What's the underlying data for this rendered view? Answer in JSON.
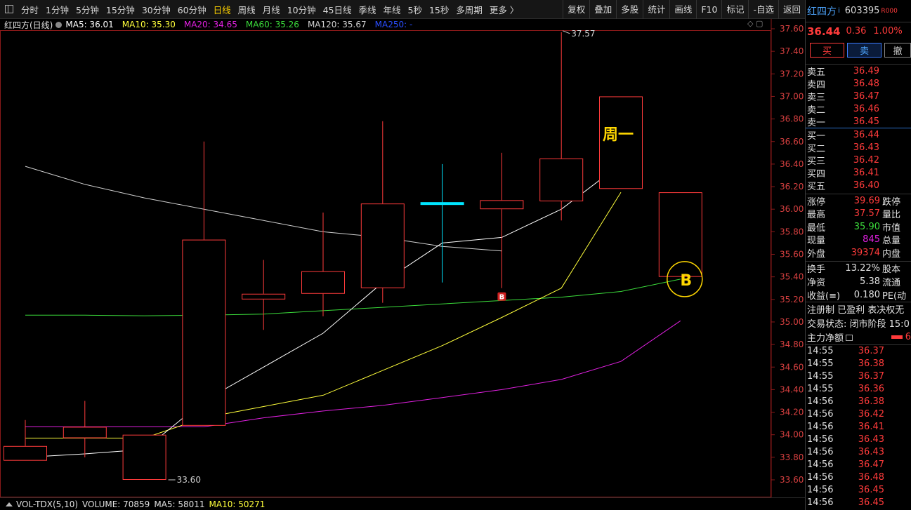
{
  "toolbar": {
    "periods": [
      "分时",
      "1分钟",
      "5分钟",
      "15分钟",
      "30分钟",
      "60分钟",
      "日线",
      "周线",
      "月线",
      "10分钟",
      "45日线",
      "季线",
      "年线",
      "5秒",
      "15秒",
      "多周期",
      "更多 〉"
    ],
    "active_index": 6,
    "right_tools": [
      "复权",
      "叠加",
      "多股",
      "统计",
      "画线",
      "F10",
      "标记",
      "-自选",
      "返回"
    ]
  },
  "ma_bar": {
    "stock": "红四方(日线)",
    "ma5": "MA5: 36.01",
    "ma10": "MA10: 35.30",
    "ma20": "MA20: 34.65",
    "ma60": "MA60: 35.26",
    "ma120": "MA120: 35.67",
    "ma250": "MA250: -"
  },
  "colors": {
    "up": "#ff3b3b",
    "down": "#00e5ff",
    "ma5": "#ffffff",
    "ma10": "#ffff3b",
    "ma20": "#e020e0",
    "ma60": "#3bdc3b",
    "ma120": "#d0d0d0",
    "ma250": "#2a4dff",
    "annotation": "#ffd700"
  },
  "chart_data": {
    "type": "candlestick",
    "ylim": [
      33.45,
      37.7
    ],
    "yticks": [
      33.6,
      33.8,
      34.0,
      34.2,
      34.4,
      34.6,
      34.8,
      35.0,
      35.2,
      35.4,
      35.6,
      35.8,
      36.0,
      36.2,
      36.4,
      36.6,
      36.8,
      37.0,
      37.2,
      37.4,
      37.6
    ],
    "candles": [
      {
        "open": 33.77,
        "high": 34.13,
        "low": 33.77,
        "close": 33.9
      },
      {
        "open": 33.97,
        "high": 34.3,
        "low": 33.8,
        "close": 34.07
      },
      {
        "open": 33.6,
        "high": 34.0,
        "low": 33.6,
        "close": 34.0
      },
      {
        "open": 34.08,
        "high": 36.6,
        "low": 34.08,
        "close": 35.73
      },
      {
        "open": 35.2,
        "high": 35.55,
        "low": 34.93,
        "close": 35.25
      },
      {
        "open": 35.25,
        "high": 35.97,
        "low": 35.05,
        "close": 35.45
      },
      {
        "open": 35.3,
        "high": 36.78,
        "low": 35.17,
        "close": 36.05
      },
      {
        "open": 36.05,
        "high": 36.4,
        "low": 35.35,
        "close": 36.05
      },
      {
        "open": 36.0,
        "high": 36.5,
        "low": 35.3,
        "close": 36.08
      },
      {
        "open": 36.07,
        "high": 37.57,
        "low": 35.9,
        "close": 36.45
      },
      {
        "open": 36.18,
        "high": 37.0,
        "low": 36.18,
        "close": 37.0
      },
      {
        "open": 36.15,
        "high": 36.15,
        "low": 35.4,
        "close": 35.4
      }
    ],
    "ma5": [
      33.8,
      33.83,
      33.87,
      34.3,
      34.6,
      34.9,
      35.35,
      35.7,
      35.75,
      36.0,
      36.4
    ],
    "ma10": [
      33.97,
      33.97,
      33.97,
      34.15,
      34.25,
      34.35,
      34.57,
      34.79,
      35.04,
      35.3,
      36.15
    ],
    "ma20": [
      34.07,
      34.07,
      34.07,
      34.07,
      34.15,
      34.21,
      34.26,
      34.33,
      34.4,
      34.49,
      34.65,
      35.01
    ],
    "ma60": [
      35.06,
      35.06,
      35.055,
      35.06,
      35.07,
      35.1,
      35.13,
      35.16,
      35.19,
      35.22,
      35.27,
      35.38
    ],
    "ma120": [
      36.38,
      36.22,
      36.1,
      36.0,
      35.9,
      35.8,
      35.75,
      35.67,
      35.63
    ],
    "high_label": "37.57",
    "low_label": "33.60",
    "annotation_text": "周一",
    "annotation_marker": "B",
    "signal_marker": "B"
  },
  "vol_bar": {
    "title": "VOL-TDX(5,10)",
    "volume": "VOLUME: 70859",
    "ma5": "MA5: 58011",
    "ma10": "MA10: 50271"
  },
  "panel": {
    "name": "红四方",
    "name_suffix": "i",
    "code": "603395",
    "code_tag": "R000",
    "price": "36.44",
    "change": "0.36",
    "pct": "1.00%",
    "buy_btn": "买",
    "sell_btn": "卖",
    "cancel_btn": "撤",
    "asks": [
      {
        "label": "卖五",
        "price": "36.49"
      },
      {
        "label": "卖四",
        "price": "36.48"
      },
      {
        "label": "卖三",
        "price": "36.47"
      },
      {
        "label": "卖二",
        "price": "36.46"
      },
      {
        "label": "卖一",
        "price": "36.45"
      }
    ],
    "bids": [
      {
        "label": "买一",
        "price": "36.44"
      },
      {
        "label": "买二",
        "price": "36.43"
      },
      {
        "label": "买三",
        "price": "36.42"
      },
      {
        "label": "买四",
        "price": "36.41"
      },
      {
        "label": "买五",
        "price": "36.40"
      }
    ],
    "stats": [
      {
        "label": "涨停",
        "value": "39.69",
        "color": "#ff3b3b",
        "label2": "跌停"
      },
      {
        "label": "最高",
        "value": "37.57",
        "color": "#ff3b3b",
        "label2": "量比"
      },
      {
        "label": "最低",
        "value": "35.90",
        "color": "#3bdc3b",
        "label2": "市值"
      },
      {
        "label": "现量",
        "value": "845",
        "color": "#e020e0",
        "label2": "总量"
      },
      {
        "label": "外盘",
        "value": "39374",
        "color": "#ff3b3b",
        "label2": "内盘"
      }
    ],
    "stats2": [
      {
        "label": "换手",
        "value": "13.22%",
        "label2": "股本"
      },
      {
        "label": "净资",
        "value": "5.38",
        "label2": "流通"
      },
      {
        "label": "收益(≡)",
        "value": "0.180",
        "label2": "PE(动"
      }
    ],
    "reg": "注册制 已盈利 表决权无",
    "trade_status": "交易状态: 闭市阶段 15:0",
    "flow_label": "主力净额",
    "flow_value": "6",
    "ticks": [
      {
        "t": "14:55",
        "v": "36.37"
      },
      {
        "t": "14:55",
        "v": "36.38"
      },
      {
        "t": "14:55",
        "v": "36.37"
      },
      {
        "t": "14:55",
        "v": "36.36"
      },
      {
        "t": "14:56",
        "v": "36.38"
      },
      {
        "t": "14:56",
        "v": "36.42"
      },
      {
        "t": "14:56",
        "v": "36.41"
      },
      {
        "t": "14:56",
        "v": "36.43"
      },
      {
        "t": "14:56",
        "v": "36.43"
      },
      {
        "t": "14:56",
        "v": "36.47"
      },
      {
        "t": "14:56",
        "v": "36.48"
      },
      {
        "t": "14:56",
        "v": "36.45"
      },
      {
        "t": "14:56",
        "v": "36.45"
      }
    ]
  }
}
